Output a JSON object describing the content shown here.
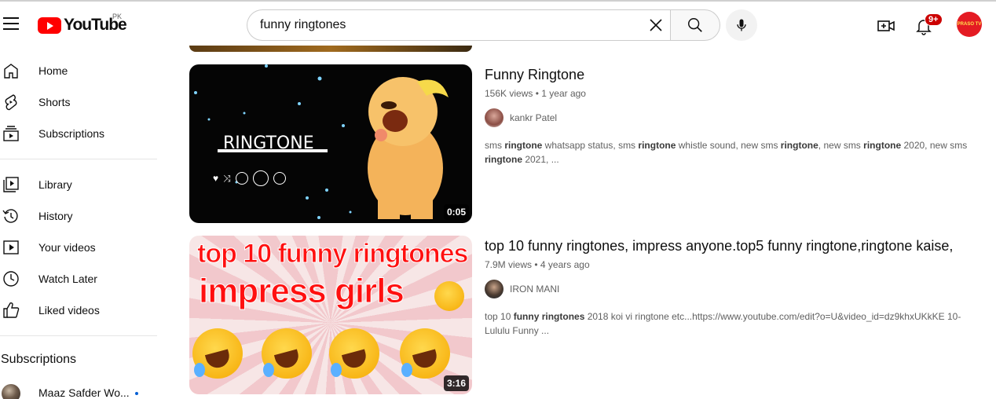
{
  "header": {
    "logo_text": "YouTube",
    "country": "PK",
    "search_value": "funny ringtones",
    "search_placeholder": "Search",
    "notification_count": "9+",
    "avatar_text": "PRASO TV"
  },
  "sidebar": {
    "main": [
      {
        "label": "Home",
        "icon": "home-icon"
      },
      {
        "label": "Shorts",
        "icon": "shorts-icon"
      },
      {
        "label": "Subscriptions",
        "icon": "subscriptions-icon"
      }
    ],
    "library": [
      {
        "label": "Library",
        "icon": "library-icon"
      },
      {
        "label": "History",
        "icon": "history-icon"
      },
      {
        "label": "Your videos",
        "icon": "your-videos-icon"
      },
      {
        "label": "Watch Later",
        "icon": "watch-later-icon"
      },
      {
        "label": "Liked videos",
        "icon": "liked-videos-icon"
      }
    ],
    "subscriptions_heading": "Subscriptions",
    "subscriptions": [
      {
        "name": "Maaz Safder Wo..."
      }
    ]
  },
  "results": [
    {
      "title": "Funny Ringtone",
      "views": "156K views",
      "age": "1 year ago",
      "channel": "kankr Patel",
      "duration": "0:05",
      "thumb_text": "RINGTONE",
      "description_parts": [
        [
          "sms ",
          false
        ],
        [
          "ringtone",
          true
        ],
        [
          " whatsapp status, sms ",
          false
        ],
        [
          "ringtone",
          true
        ],
        [
          " whistle sound, new sms ",
          false
        ],
        [
          "ringtone",
          true
        ],
        [
          ", new sms ",
          false
        ],
        [
          "ringtone",
          true
        ],
        [
          " 2020, new sms ",
          false
        ],
        [
          "ringtone",
          true
        ],
        [
          " 2021, ...",
          false
        ]
      ]
    },
    {
      "title": "top 10 funny ringtones, impress anyone.top5 funny ringtone,ringtone kaise,",
      "views": "7.9M views",
      "age": "4 years ago",
      "channel": "IRON MANI",
      "duration": "3:16",
      "thumb_line1": "top 10 funny ringtones",
      "thumb_line2": "impress girls",
      "description_parts": [
        [
          "top 10 ",
          false
        ],
        [
          "funny ringtones",
          true
        ],
        [
          " 2018 koi vi ringtone etc...https://www.youtube.com/edit?o=U&video_id=dz9khxUKkKE 10-Lululu Funny ...",
          false
        ]
      ]
    }
  ],
  "separator": "•",
  "colors": {
    "brand_red": "#ff0000",
    "badge_red": "#cc0000",
    "text_primary": "#0f0f0f",
    "text_secondary": "#606060"
  }
}
